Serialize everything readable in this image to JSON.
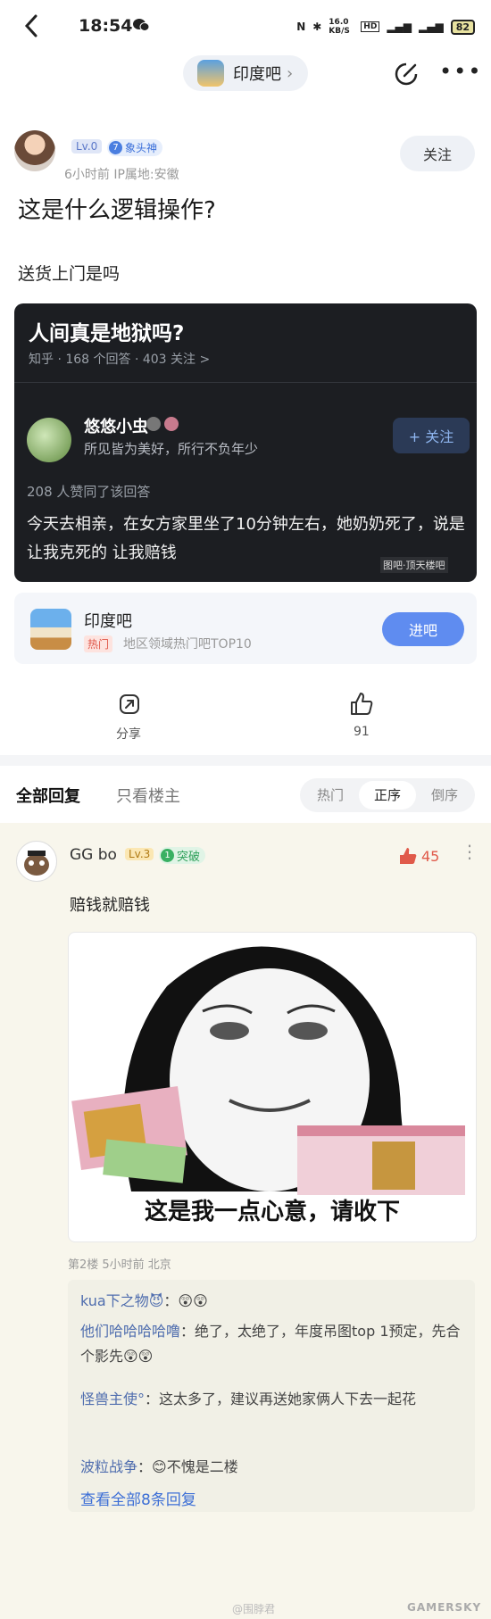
{
  "status_bar": {
    "time": "18:54",
    "net_speed": "16.0 KB/S",
    "battery": "82"
  },
  "nav": {
    "forum_name": "印度吧"
  },
  "post": {
    "author_level": "Lv.0",
    "rank_num": "7",
    "rank_title": "象头神",
    "meta": "6小时前   IP属地:安徽",
    "follow_label": "关注",
    "title": "这是什么逻辑操作?",
    "body": "送货上门是吗"
  },
  "embed": {
    "title": "人间真是地狱吗?",
    "stats": "知乎 · 168 个回答 · 403 关注 >",
    "author": "悠悠小虫",
    "signature": "所见皆为美好，所行不负年少",
    "follow_label": "+ 关注",
    "agree": "208 人赞同了该回答",
    "answer": "今天去相亲，在女方家里坐了10分钟左右，她奶奶死了，说是让我克死的 让我赔钱",
    "watermark": "图吧·顶天楼吧"
  },
  "forum_card": {
    "name": "印度吧",
    "tag": "热门",
    "desc": "地区领域热门吧TOP10",
    "enter_label": "进吧"
  },
  "actions": {
    "share_label": "分享",
    "like_count": "91"
  },
  "reply_tabs": {
    "all": "全部回复",
    "op_only": "只看楼主",
    "sort": [
      "热门",
      "正序",
      "倒序"
    ],
    "active_sort": "正序"
  },
  "reply": {
    "name": "GG bo",
    "level": "Lv.3",
    "rank_num": "1",
    "rank_title": "突破",
    "likes": "45",
    "text": "赔钱就赔钱",
    "meme_caption": "这是我一点心意，请收下",
    "floor_meta": "第2楼  5小时前  北京",
    "sub_replies": [
      {
        "user": "kua下之物😈",
        "text": "：😲😲"
      },
      {
        "user": "他们哈哈哈哈噜",
        "text": "：绝了，太绝了，年度吊图top 1预定，先合个影先😲😲"
      },
      {
        "user": "怪兽主使°",
        "text": "：这太多了，建议再送她家俩人下去一起花"
      },
      {
        "user": "波粒战争",
        "text": "：😊不愧是二楼"
      }
    ],
    "view_all": "查看全部8条回复"
  },
  "watermarks": {
    "weibo": "@围脖君",
    "site": "GAMERSKY"
  }
}
